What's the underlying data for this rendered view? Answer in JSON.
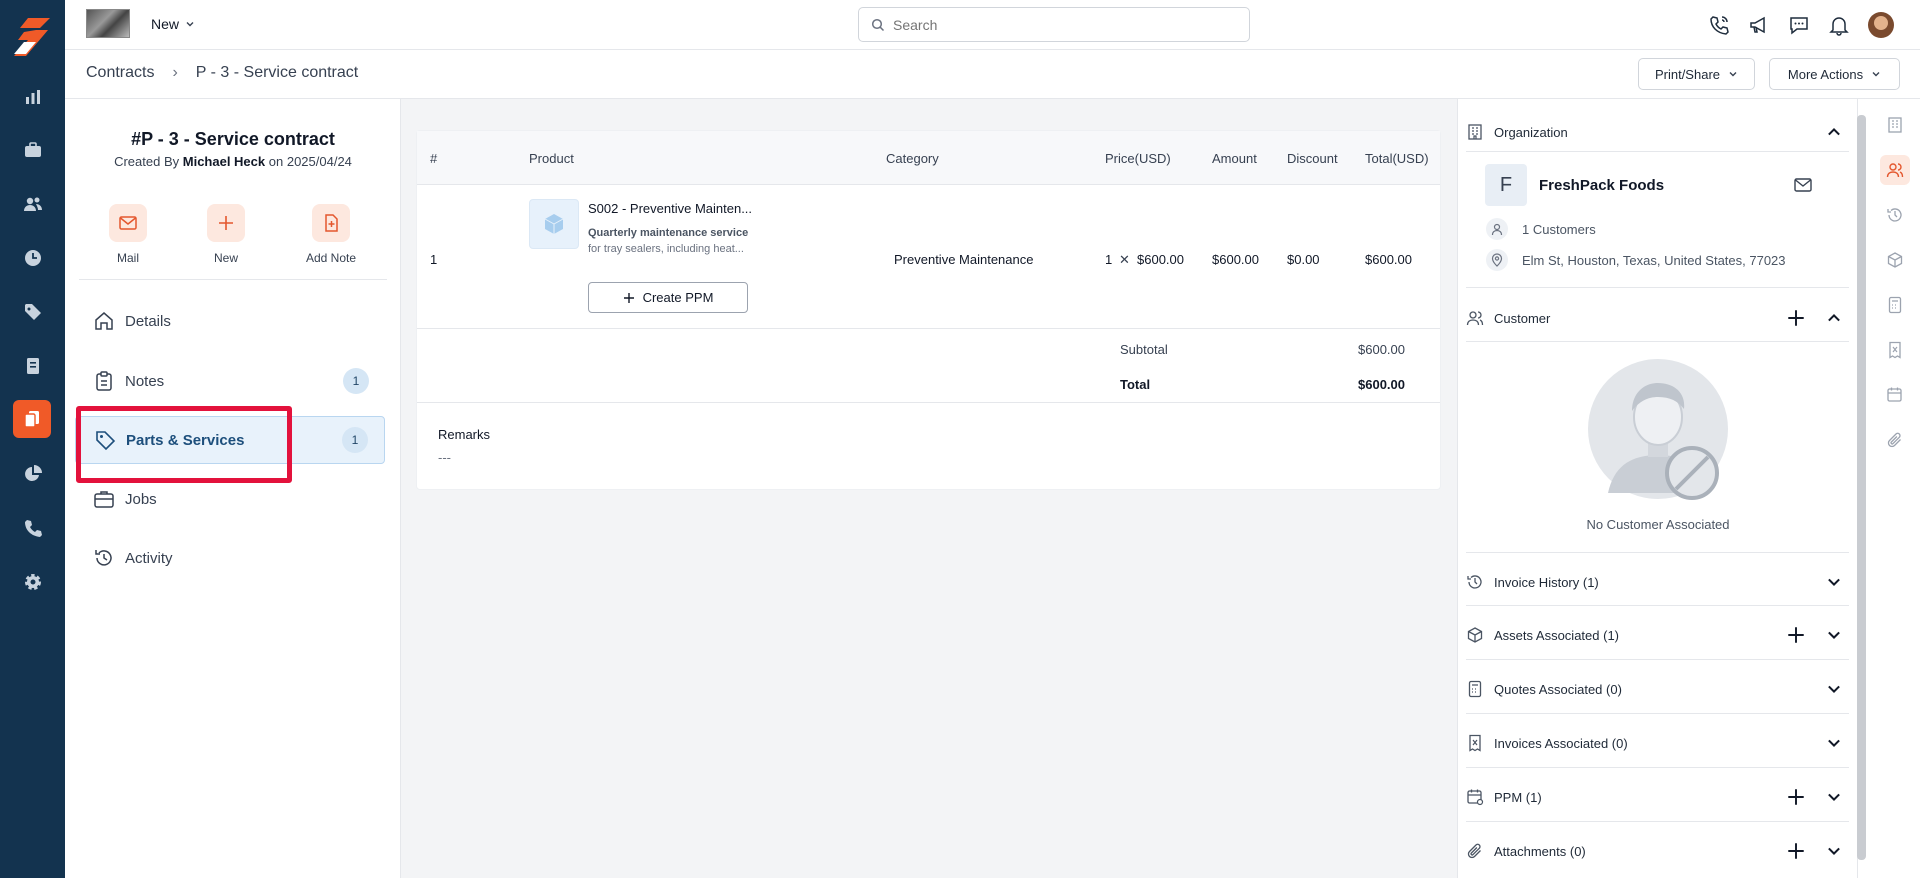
{
  "topbar": {
    "new_label": "New",
    "search_placeholder": "Search"
  },
  "breadcrumb": {
    "root": "Contracts",
    "current": "P - 3 - Service contract"
  },
  "actions": {
    "print_share": "Print/Share",
    "more_actions": "More Actions"
  },
  "contract": {
    "title": "#P - 3 - Service contract",
    "created_prefix": "Created By",
    "created_by": "Michael Heck",
    "created_on_prefix": "on",
    "created_on": "2025/04/24"
  },
  "quick_actions": [
    {
      "label": "Mail",
      "icon": "mail-icon"
    },
    {
      "label": "New",
      "icon": "plus-icon"
    },
    {
      "label": "Add Note",
      "icon": "add-note-icon"
    }
  ],
  "nav": [
    {
      "label": "Details",
      "icon": "home-icon",
      "count": ""
    },
    {
      "label": "Notes",
      "icon": "clipboard-icon",
      "count": "1"
    },
    {
      "label": "Parts & Services",
      "icon": "tag-icon",
      "count": "1",
      "active": true
    },
    {
      "label": "Jobs",
      "icon": "briefcase-icon",
      "count": ""
    },
    {
      "label": "Activity",
      "icon": "history-icon",
      "count": ""
    }
  ],
  "table": {
    "headers": [
      "#",
      "Product",
      "Category",
      "Price(USD)",
      "Amount",
      "Discount",
      "Total(USD)"
    ],
    "rows": [
      {
        "num": "1",
        "product_name": "S002 - Preventive Mainten...",
        "desc_bold": "Quarterly maintenance service",
        "desc": "for tray sealers, including heat...",
        "category": "Preventive Maintenance",
        "qty": "1",
        "times": "✕",
        "price": "$600.00",
        "amount": "$600.00",
        "discount": "$0.00",
        "total": "$600.00",
        "create_ppm": "Create PPM"
      }
    ],
    "subtotal_label": "Subtotal",
    "subtotal": "$600.00",
    "total_label": "Total",
    "total": "$600.00",
    "remarks_label": "Remarks",
    "remarks_value": "---"
  },
  "right_panel": {
    "organization": {
      "label": "Organization",
      "initial": "F",
      "name": "FreshPack Foods",
      "customers": "1 Customers",
      "address": "Elm St, Houston, Texas, United States, 77023"
    },
    "customer": {
      "label": "Customer",
      "empty": "No Customer Associated"
    },
    "sections": [
      {
        "label": "Invoice History (1)",
        "add": false
      },
      {
        "label": "Assets Associated (1)",
        "add": true
      },
      {
        "label": "Quotes Associated (0)",
        "add": false
      },
      {
        "label": "Invoices Associated (0)",
        "add": false
      },
      {
        "label": "PPM (1)",
        "add": true
      },
      {
        "label": "Attachments (0)",
        "add": true
      }
    ]
  },
  "colors": {
    "brand_orange": "#f05a28",
    "rail_navy": "#13334f",
    "highlight_red": "#e3123c",
    "active_blue": "#e8f2fb"
  }
}
